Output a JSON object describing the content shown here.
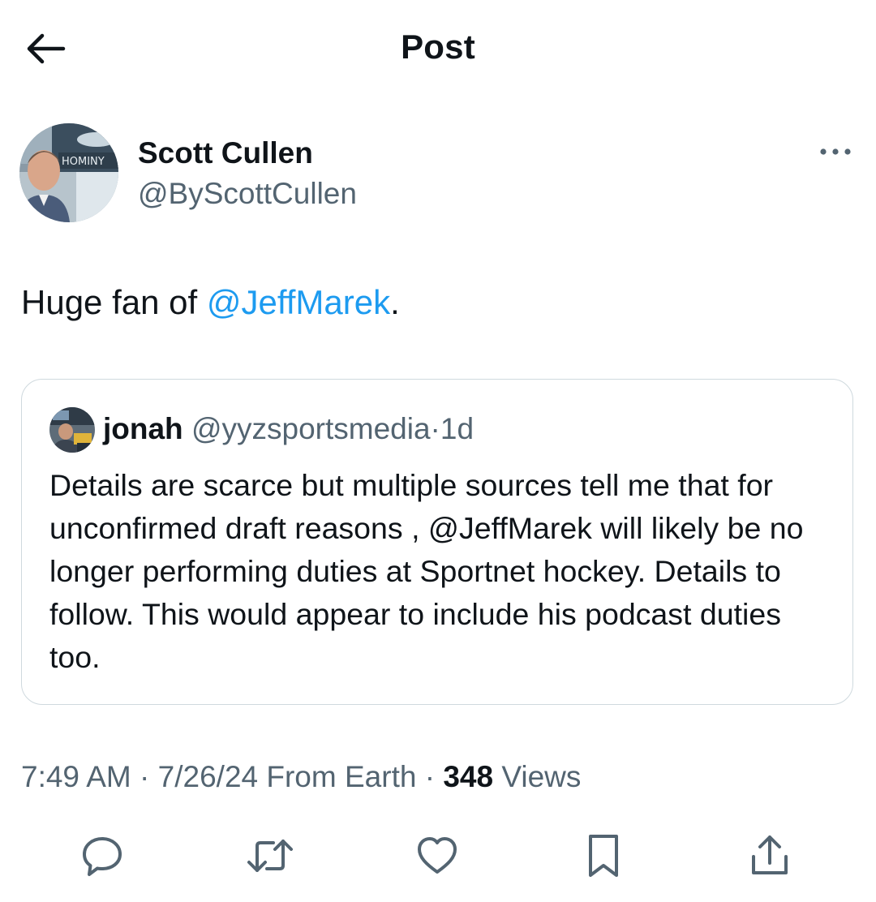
{
  "header": {
    "title": "Post",
    "back_icon": "arrow-left-icon"
  },
  "post": {
    "author": {
      "name": "Scott Cullen",
      "handle": "@ByScottCullen",
      "avatar_sign_text": "HOMINY"
    },
    "text": {
      "before": "Huge fan of ",
      "mention": "@JeffMarek",
      "after": "."
    },
    "quote": {
      "name": "jonah",
      "handle": "@yyzsportsmedia",
      "separator": "·",
      "time": "1d",
      "body": "Details are scarce but multiple sources tell me that for unconfirmed draft reasons , @JeffMarek will likely be no longer performing duties at Sportnet hockey.  Details to follow. This would appear to include his podcast duties too."
    },
    "meta": {
      "time": "7:49 AM",
      "sep1": " · ",
      "date": "7/26/24",
      "source": " From Earth",
      "sep2": " · ",
      "views_count": "348",
      "views_label": " Views"
    }
  },
  "actions": [
    {
      "name": "reply",
      "icon": "reply-icon"
    },
    {
      "name": "repost",
      "icon": "repost-icon"
    },
    {
      "name": "like",
      "icon": "heart-icon"
    },
    {
      "name": "bookmark",
      "icon": "bookmark-icon"
    },
    {
      "name": "share",
      "icon": "share-icon"
    }
  ],
  "colors": {
    "text": "#0f1419",
    "secondary": "#536471",
    "link": "#1d9bf0",
    "border": "#cfd9de"
  }
}
